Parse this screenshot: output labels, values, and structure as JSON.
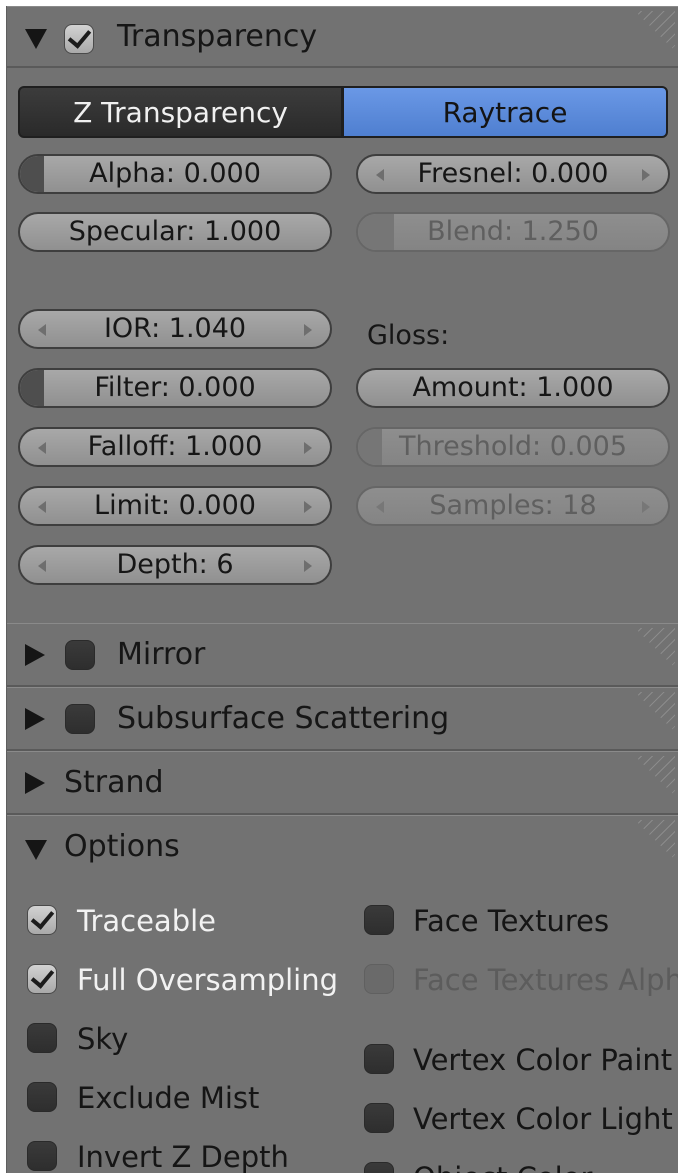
{
  "transparency": {
    "title": "Transparency",
    "enabled": true,
    "modes": [
      "Z Transparency",
      "Raytrace"
    ],
    "active_mode": "Raytrace",
    "alpha": "Alpha: 0.000",
    "fresnel": "Fresnel: 0.000",
    "specular": "Specular: 1.000",
    "blend": "Blend: 1.250",
    "ior": "IOR: 1.040",
    "gloss_label": "Gloss:",
    "filter": "Filter: 0.000",
    "amount": "Amount: 1.000",
    "falloff": "Falloff: 1.000",
    "threshold": "Threshold: 0.005",
    "limit": "Limit: 0.000",
    "samples": "Samples: 18",
    "depth": "Depth: 6"
  },
  "sections": {
    "mirror": "Mirror",
    "sss": "Subsurface Scattering",
    "strand": "Strand",
    "options": "Options"
  },
  "options": {
    "traceable": "Traceable",
    "full_oversampling": "Full Oversampling",
    "sky": "Sky",
    "exclude_mist": "Exclude Mist",
    "invert_z_depth": "Invert Z Depth",
    "face_textures": "Face Textures",
    "face_textures_alpha": "Face Textures Alph",
    "vertex_color_paint": "Vertex Color Paint",
    "vertex_color_light": "Vertex Color Light",
    "object_color": "Object Color"
  },
  "colors": {
    "panel_bg": "#727272",
    "accent_blue": "#5683d4"
  }
}
